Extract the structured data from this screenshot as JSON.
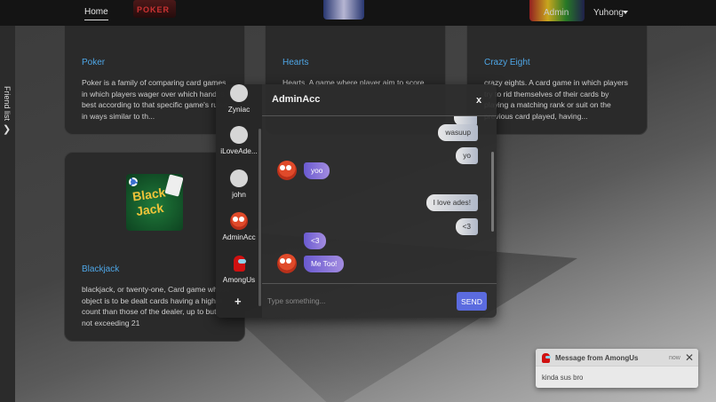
{
  "navbar": {
    "home_label": "Home",
    "logo_text": "POKER",
    "admin_label": "Admin",
    "user_label": "Yuhong"
  },
  "friend_tab": {
    "label": "Friend list"
  },
  "cards": [
    {
      "title": "Poker",
      "description_lines": [
        "Poker is a family of comparing card games",
        "in which players wager over which hand is",
        "best according to that specific game's rules",
        "in ways similar to th..."
      ]
    },
    {
      "title": "Hearts",
      "description_lines": [
        "Hearts. A game where player aim to score"
      ]
    },
    {
      "title": "Crazy Eight",
      "description_lines": [
        "crazy eights. A card game in which players",
        "try to rid themselves of their cards by",
        "playing a matching rank or suit on the",
        "previous card played, having..."
      ]
    },
    {
      "title": "Blackjack",
      "image_text": [
        "Black",
        "Jack"
      ],
      "description_lines": [
        "blackjack, or twenty-one, Card game whose",
        "object is to be dealt cards having a higher",
        "count than those of the dealer, up to but",
        "not exceeding 21"
      ]
    }
  ],
  "chat": {
    "friends": [
      {
        "name": "Zyniac",
        "avatar": "default-avatar"
      },
      {
        "name": "iLoveAde...",
        "avatar": "default-avatar"
      },
      {
        "name": "john",
        "avatar": "default-avatar"
      },
      {
        "name": "AdminAcc",
        "avatar": "elmo-avatar"
      },
      {
        "name": "AmongUs",
        "avatar": "among-us-avatar"
      }
    ],
    "add_label": "+",
    "title": "AdminAcc",
    "close_label": "x",
    "messages": [
      {
        "dir": "out",
        "text": "wasuup"
      },
      {
        "dir": "out",
        "text": "yo"
      },
      {
        "dir": "in",
        "text": "yoo"
      },
      {
        "dir": "out",
        "text": "I love ades!"
      },
      {
        "dir": "out",
        "text": "<3"
      },
      {
        "dir": "in",
        "text": "<3"
      },
      {
        "dir": "in",
        "text": "Me Too!"
      }
    ],
    "input_placeholder": "Type something...",
    "send_label": "SEND"
  },
  "toast": {
    "title": "Message from AmongUs",
    "time": "now",
    "body": "kinda sus bro"
  }
}
